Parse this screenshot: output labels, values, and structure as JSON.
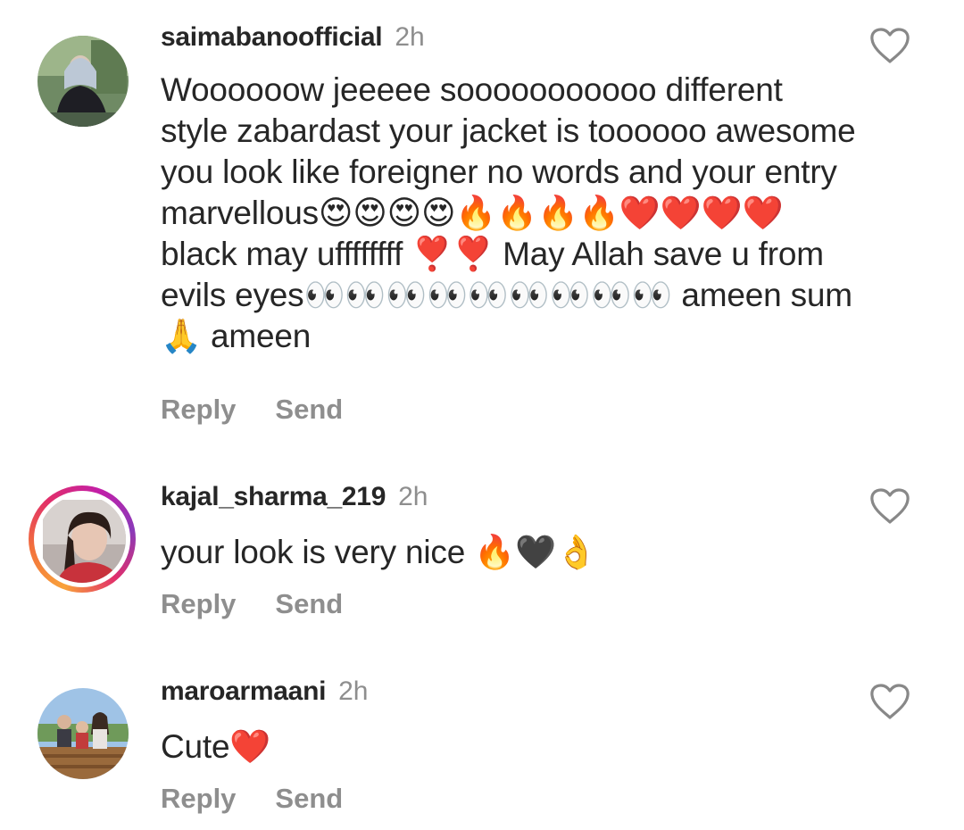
{
  "comments": [
    {
      "username": "saimabanoofficial",
      "time": "2h",
      "text": "Woooooow jeeeee sooooooooooo different style zabardast your jacket is toooooo awesome you look like foreigner  no words and your entry marvellous😍😍😍😍🔥🔥🔥🔥❤️❤️❤️❤️ black may uffffffff ❣️❣️ May Allah save u from evils eyes👀👀👀👀👀👀👀👀👀 ameen sum🙏 ameen",
      "reply_label": "Reply",
      "send_label": "Send",
      "avatar": "avatar-photo-woman-headscarf",
      "has_story_ring": false
    },
    {
      "username": "kajal_sharma_219",
      "time": "2h",
      "text": "your look is very nice 🔥🖤👌",
      "reply_label": "Reply",
      "send_label": "Send",
      "avatar": "avatar-photo-girl",
      "has_story_ring": true
    },
    {
      "username": "maroarmaani",
      "time": "2h",
      "text": "Cute❤️",
      "reply_label": "Reply",
      "send_label": "Send",
      "avatar": "avatar-photo-family",
      "has_story_ring": false
    }
  ],
  "colors": {
    "text_primary": "#262626",
    "text_secondary": "#8e8e8e",
    "background": "#ffffff",
    "story_ring_start": "#f9a23b",
    "story_ring_end": "#c21fa8"
  },
  "icons": {
    "like": "heart-outline-icon"
  }
}
